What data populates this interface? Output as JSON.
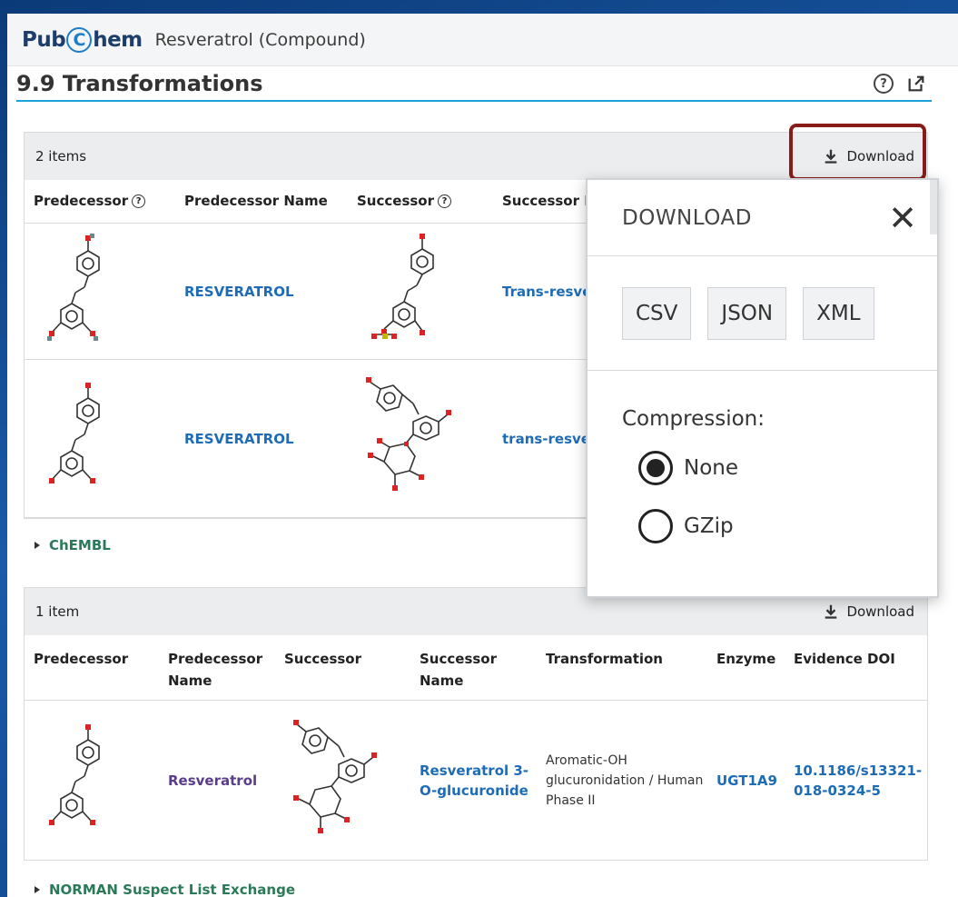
{
  "app": {
    "logo_pre": "Pub",
    "logo_c": "C",
    "logo_post": "hem",
    "title": "Resveratrol (Compound)"
  },
  "section": {
    "title": "9.9 Transformations",
    "help_icon": "help-icon",
    "external_icon": "external-link-icon"
  },
  "table1": {
    "count": "2 items",
    "download_label": "Download",
    "headers": [
      "Predecessor",
      "Predecessor Name",
      "Successor",
      "Successor N"
    ],
    "rows": [
      {
        "predecessor_name": "RESVERATROL",
        "successor_name": "Trans-resver"
      },
      {
        "predecessor_name": "RESVERATROL",
        "successor_name": "trans-resver"
      }
    ]
  },
  "expander1": "ChEMBL",
  "table2": {
    "count": "1 item",
    "download_label": "Download",
    "headers": [
      "Predecessor",
      "Predecessor Name",
      "Successor",
      "Successor Name",
      "Transformation",
      "Enzyme",
      "Evidence DOI"
    ],
    "rows": [
      {
        "predecessor_name": "Resveratrol",
        "successor_name": "Resveratrol 3-O-glucuronide",
        "transformation": "Aromatic-OH glucuronidation / Human Phase II",
        "enzyme": "UGT1A9",
        "doi": "10.1186/s13321-018-0324-5"
      }
    ]
  },
  "expander2": "NORMAN Suspect List Exchange",
  "download_popup": {
    "title": "DOWNLOAD",
    "close": "✕",
    "formats": [
      "CSV",
      "JSON",
      "XML"
    ],
    "compression_label": "Compression:",
    "options": [
      "None",
      "GZip"
    ],
    "selected": "None"
  },
  "colors": {
    "link": "#1e6cb5",
    "accent": "#1aa3d9",
    "highlight": "#8a1b1b"
  }
}
